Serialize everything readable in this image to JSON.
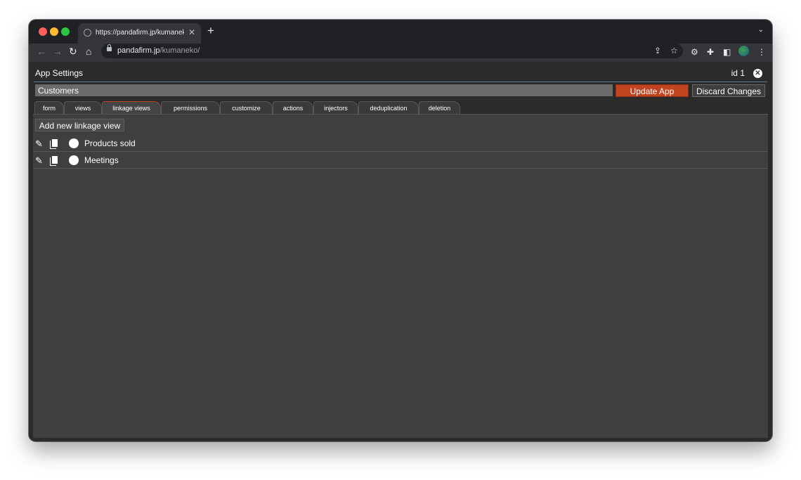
{
  "browser": {
    "tab_title": "https://pandafirm.jp/kumaneko/",
    "tab_close": "✕",
    "new_tab": "+",
    "url_host": "pandafirm.jp",
    "url_path": "/kumaneko/",
    "icons": {
      "back": "←",
      "forward": "→",
      "reload": "↻",
      "home": "⌂",
      "share": "⇪",
      "bookmark": "☆",
      "extension": "⚙",
      "puzzle": "✚",
      "sidepanel": "◧",
      "menu": "⋮",
      "tab_menu": "⌄"
    }
  },
  "app": {
    "title": "App Settings",
    "id_label": "id 1",
    "close_glyph": "✕",
    "name_value": "Customers",
    "update_label": "Update App",
    "discard_label": "Discard Changes",
    "update_color": "#c0441f"
  },
  "tabs": [
    {
      "label": "form"
    },
    {
      "label": "views"
    },
    {
      "label": "linkage views",
      "active": true
    },
    {
      "label": "permissions"
    },
    {
      "label": "customize"
    },
    {
      "label": "actions"
    },
    {
      "label": "injectors"
    },
    {
      "label": "deduplication"
    },
    {
      "label": "deletion"
    }
  ],
  "linkage": {
    "add_label": "Add new linkage view",
    "items": [
      {
        "label": "Products sold"
      },
      {
        "label": "Meetings"
      }
    ],
    "icons": {
      "edit": "✎",
      "delete": "✕"
    }
  }
}
